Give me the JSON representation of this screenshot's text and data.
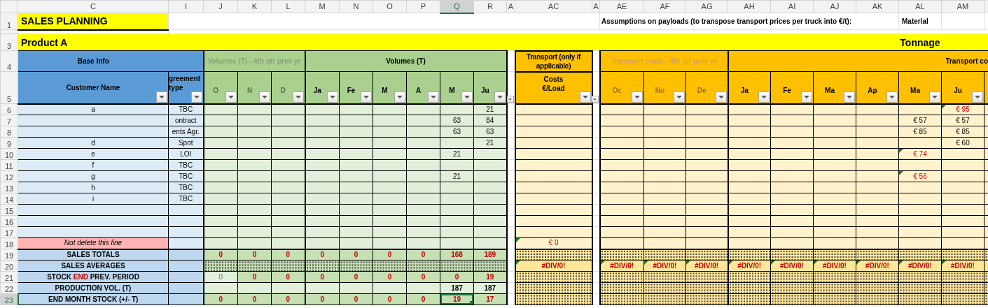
{
  "column_headers": [
    {
      "label": "C",
      "selected": false
    },
    {
      "label": "I",
      "selected": false
    },
    {
      "label": "J",
      "selected": false
    },
    {
      "label": "K",
      "selected": false
    },
    {
      "label": "L",
      "selected": false
    },
    {
      "label": "M",
      "selected": false
    },
    {
      "label": "N",
      "selected": false
    },
    {
      "label": "O",
      "selected": false
    },
    {
      "label": "P",
      "selected": false
    },
    {
      "label": "Q",
      "selected": true
    },
    {
      "label": "R",
      "selected": false
    },
    {
      "label": "A",
      "selected": false
    },
    {
      "label": "AC",
      "selected": false
    },
    {
      "label": "A",
      "selected": false
    },
    {
      "label": "AE",
      "selected": false
    },
    {
      "label": "AF",
      "selected": false
    },
    {
      "label": "AG",
      "selected": false
    },
    {
      "label": "AH",
      "selected": false
    },
    {
      "label": "AI",
      "selected": false
    },
    {
      "label": "AJ",
      "selected": false
    },
    {
      "label": "AK",
      "selected": false
    },
    {
      "label": "AL",
      "selected": false
    },
    {
      "label": "AM",
      "selected": false
    }
  ],
  "row_numbers": [
    {
      "label": "1",
      "selected": false
    },
    {
      "label": "3",
      "selected": false
    },
    {
      "label": "4",
      "selected": false
    },
    {
      "label": "5",
      "selected": false
    },
    {
      "label": "6",
      "selected": false
    },
    {
      "label": "7",
      "selected": false
    },
    {
      "label": "8",
      "selected": false
    },
    {
      "label": "9",
      "selected": false
    },
    {
      "label": "10",
      "selected": false
    },
    {
      "label": "11",
      "selected": false
    },
    {
      "label": "12",
      "selected": false
    },
    {
      "label": "13",
      "selected": false
    },
    {
      "label": "14",
      "selected": false
    },
    {
      "label": "15",
      "selected": false
    },
    {
      "label": "16",
      "selected": false
    },
    {
      "label": "17",
      "selected": false
    },
    {
      "label": "18",
      "selected": false
    },
    {
      "label": "19",
      "selected": false
    },
    {
      "label": "20",
      "selected": false
    },
    {
      "label": "21",
      "selected": false
    },
    {
      "label": "22",
      "selected": false
    },
    {
      "label": "23",
      "selected": true
    }
  ],
  "title": "SALES PLANNING",
  "assumptions_note": "Assumptions on payloads (to transpose transport prices per truck into €/t):",
  "material_label": "Material",
  "product": "Product A",
  "tonnage_label": "Tonnage",
  "group_headers": [
    {
      "label": "Base Info",
      "muted": false
    },
    {
      "label": "Volumes (T) - 4th qtr prev yr",
      "muted": true
    },
    {
      "label": "Volumes (T)",
      "muted": false
    },
    {
      "label": "Transport (only if applicable)",
      "muted": false
    },
    {
      "label": "Transport costs - 4th qtr prev yr",
      "muted": true
    },
    {
      "label": "Transport co",
      "muted": false
    }
  ],
  "field_headers": {
    "customer": "Customer Name",
    "agreement": "greement type",
    "transport": "Costs €/Load",
    "volume_months": [
      {
        "label": "O",
        "muted": true
      },
      {
        "label": "N",
        "muted": true
      },
      {
        "label": "D",
        "muted": true
      },
      {
        "label": "Ja",
        "muted": false
      },
      {
        "label": "Fe",
        "muted": false
      },
      {
        "label": "M",
        "muted": false
      },
      {
        "label": "A",
        "muted": false
      },
      {
        "label": "M",
        "muted": false
      },
      {
        "label": "Ju",
        "muted": false
      }
    ],
    "cost_months": [
      {
        "label": "Oc",
        "muted": true
      },
      {
        "label": "No",
        "muted": true
      },
      {
        "label": "De",
        "muted": true
      },
      {
        "label": "Ja",
        "muted": false
      },
      {
        "label": "Fe",
        "muted": false
      },
      {
        "label": "Ma",
        "muted": false
      },
      {
        "label": "Ap",
        "muted": false
      },
      {
        "label": "Ma",
        "muted": false
      },
      {
        "label": "Ju",
        "muted": false
      }
    ]
  },
  "rows": [
    {
      "kind": "customer",
      "customer": "a",
      "agreement": "TBC",
      "volumes": {
        "jun": "21"
      },
      "costs": {
        "jun": {
          "text": "€ 95",
          "flagged": true
        }
      }
    },
    {
      "kind": "customer",
      "agreement": "ontract",
      "volumes": {
        "may": "63",
        "jun": "84"
      },
      "costs": {
        "may": {
          "text": "€ 57",
          "flagged": false
        },
        "jun": {
          "text": "€ 57",
          "flagged": false
        }
      }
    },
    {
      "kind": "customer",
      "agreement": "ents Agr.",
      "volumes": {
        "may": "63",
        "jun": "63"
      },
      "costs": {
        "may": {
          "text": "€ 85",
          "flagged": false
        },
        "jun": {
          "text": "€ 85",
          "flagged": false
        }
      }
    },
    {
      "kind": "customer",
      "customer": "d",
      "agreement": "Spot",
      "volumes": {
        "jun": "21"
      },
      "costs": {
        "jun": {
          "text": "€ 60",
          "flagged": false
        }
      }
    },
    {
      "kind": "customer",
      "customer": "e",
      "agreement": "LOI",
      "volumes": {
        "may": "21"
      },
      "costs": {
        "may": {
          "text": "€ 74",
          "flagged": true
        }
      }
    },
    {
      "kind": "customer",
      "customer": "f",
      "agreement": "TBC"
    },
    {
      "kind": "customer",
      "customer": "g",
      "agreement": "TBC",
      "volumes": {
        "may": "21"
      },
      "costs": {
        "may": {
          "text": "€ 56",
          "flagged": true
        }
      }
    },
    {
      "kind": "customer",
      "customer": "h",
      "agreement": "TBC"
    },
    {
      "kind": "customer",
      "customer": "i",
      "agreement": "TBC"
    },
    {
      "kind": "customer"
    },
    {
      "kind": "customer"
    },
    {
      "kind": "customer"
    },
    {
      "kind": "reserved",
      "customer": "Not delete this line",
      "transport": {
        "text": "€ 0",
        "flagged": true
      }
    }
  ],
  "summary_rows": [
    {
      "label": [
        {
          "text": "SALES TOTALS",
          "accent": false
        }
      ],
      "dotted_volumes": false,
      "volumes": {
        "oct": {
          "text": "0",
          "kind": "alert"
        },
        "nov": {
          "text": "0",
          "kind": "alert"
        },
        "dec": {
          "text": "0",
          "kind": "alert"
        },
        "jan": {
          "text": "0",
          "kind": "alert"
        },
        "feb": {
          "text": "0",
          "kind": "alert"
        },
        "mar": {
          "text": "0",
          "kind": "alert"
        },
        "apr": {
          "text": "0",
          "kind": "alert"
        },
        "may": {
          "text": "168",
          "kind": "alert"
        },
        "jun": {
          "text": "189",
          "kind": "alert"
        }
      }
    },
    {
      "label": [
        {
          "text": "SALES AVERAGES",
          "accent": false
        }
      ],
      "dotted_volumes": true,
      "transport": {
        "text": "#DIV/0!",
        "flagged": true
      },
      "costs": {
        "oct": {
          "text": "#DIV/0!",
          "flagged": true
        },
        "nov": {
          "text": "#DIV/0!",
          "flagged": true
        },
        "dec": {
          "text": "#DIV/0!",
          "flagged": true
        },
        "jan": {
          "text": "#DIV/0!",
          "flagged": true
        },
        "feb": {
          "text": "#DIV/0!",
          "flagged": true
        },
        "mar": {
          "text": "#DIV/0!",
          "flagged": true
        },
        "apr": {
          "text": "#DIV/0!",
          "flagged": true
        },
        "may": {
          "text": "#DIV/0!",
          "flagged": true
        },
        "jun": {
          "text": "#DIV/0!",
          "flagged": true
        }
      }
    },
    {
      "label": [
        {
          "text": "STOCK ",
          "accent": false
        },
        {
          "text": "END",
          "accent": true
        },
        {
          "text": " PREV. PERIOD",
          "accent": false
        }
      ],
      "dotted_volumes": false,
      "volumes": {
        "oct": {
          "text": "0",
          "kind": "muted"
        },
        "nov": {
          "text": "0",
          "kind": "alert"
        },
        "dec": {
          "text": "0",
          "kind": "alert"
        },
        "jan": {
          "text": "0",
          "kind": "alert"
        },
        "feb": {
          "text": "0",
          "kind": "alert"
        },
        "mar": {
          "text": "0",
          "kind": "alert"
        },
        "apr": {
          "text": "0",
          "kind": "alert"
        },
        "may": {
          "text": "0",
          "kind": "alert"
        },
        "jun": {
          "text": "19",
          "kind": "alert"
        }
      }
    },
    {
      "label": [
        {
          "text": "PRODUCTION VOL. (T)",
          "accent": false
        }
      ],
      "dotted_volumes": false,
      "volumes": {
        "may": {
          "text": "187",
          "kind": "total"
        },
        "jun": {
          "text": "187",
          "kind": "total"
        }
      }
    },
    {
      "label": [
        {
          "text": "END MONTH STOCK (+/- T)",
          "accent": false
        }
      ],
      "dotted_volumes": false,
      "volumes": {
        "oct": {
          "text": "0",
          "kind": "alert"
        },
        "nov": {
          "text": "0",
          "kind": "alert"
        },
        "dec": {
          "text": "0",
          "kind": "alert"
        },
        "jan": {
          "text": "0",
          "kind": "alert"
        },
        "feb": {
          "text": "0",
          "kind": "alert"
        },
        "mar": {
          "text": "0",
          "kind": "alert"
        },
        "apr": {
          "text": "0",
          "kind": "alert"
        },
        "may": {
          "text": "19",
          "kind": "alert"
        },
        "jun": {
          "text": "17",
          "kind": "alert"
        }
      }
    }
  ]
}
